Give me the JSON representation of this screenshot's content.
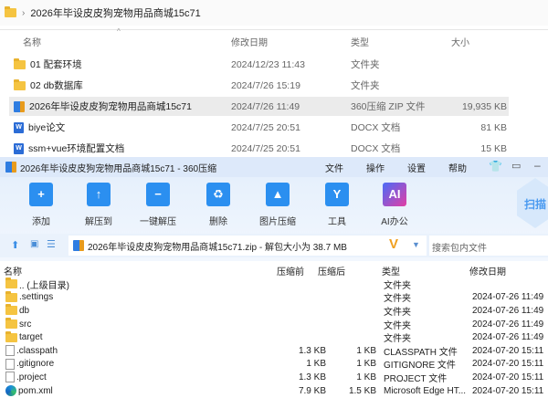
{
  "explorer": {
    "breadcrumb": "2026年毕设皮皮狗宠物用品商城15c71",
    "columns": {
      "name": "名称",
      "date": "修改日期",
      "type": "类型",
      "size": "大小"
    },
    "rows": [
      {
        "icon": "folder",
        "name": "01 配套环境",
        "date": "2024/12/23 11:43",
        "type": "文件夹",
        "size": ""
      },
      {
        "icon": "folder",
        "name": "02 db数据库",
        "date": "2024/7/26 15:19",
        "type": "文件夹",
        "size": ""
      },
      {
        "icon": "zip",
        "name": "2026年毕设皮皮狗宠物用品商城15c71",
        "date": "2024/7/26 11:49",
        "type": "360压缩 ZIP 文件",
        "size": "19,935 KB",
        "selected": true
      },
      {
        "icon": "word",
        "name": "biye论文",
        "date": "2024/7/25 20:51",
        "type": "DOCX 文档",
        "size": "81 KB"
      },
      {
        "icon": "word",
        "name": "ssm+vue环境配置文档",
        "date": "2024/7/25 20:51",
        "type": "DOCX 文档",
        "size": "15 KB"
      }
    ]
  },
  "zip": {
    "title": "2026年毕设皮皮狗宠物用品商城15c71 - 360压缩",
    "menu": [
      "文件",
      "操作",
      "设置",
      "帮助"
    ],
    "tools": [
      {
        "label": "添加",
        "glyph": "+"
      },
      {
        "label": "解压到",
        "glyph": "↑"
      },
      {
        "label": "一键解压",
        "glyph": "−"
      },
      {
        "label": "删除",
        "glyph": "♻"
      },
      {
        "label": "图片压缩",
        "glyph": "▲"
      },
      {
        "label": "工具",
        "glyph": "Y"
      },
      {
        "label": "AI办公",
        "glyph": "AI"
      }
    ],
    "scan_label": "扫描",
    "path": "2026年毕设皮皮狗宠物用品商城15c71.zip - 解包大小为 38.7 MB",
    "search_placeholder": "搜索包内文件",
    "columns": {
      "name": "名称",
      "before": "压缩前",
      "after": "压缩后",
      "type": "类型",
      "date": "修改日期"
    },
    "rows": [
      {
        "icon": "folder",
        "name": ".. (上级目录)",
        "before": "",
        "after": "",
        "type": "文件夹",
        "date": ""
      },
      {
        "icon": "folder",
        "name": ".settings",
        "before": "",
        "after": "",
        "type": "文件夹",
        "date": "2024-07-26 11:49"
      },
      {
        "icon": "folder",
        "name": "db",
        "before": "",
        "after": "",
        "type": "文件夹",
        "date": "2024-07-26 11:49"
      },
      {
        "icon": "folder",
        "name": "src",
        "before": "",
        "after": "",
        "type": "文件夹",
        "date": "2024-07-26 11:49"
      },
      {
        "icon": "folder",
        "name": "target",
        "before": "",
        "after": "",
        "type": "文件夹",
        "date": "2024-07-26 11:49"
      },
      {
        "icon": "file",
        "name": ".classpath",
        "before": "1.3 KB",
        "after": "1 KB",
        "type": "CLASSPATH 文件",
        "date": "2024-07-20 15:11"
      },
      {
        "icon": "file",
        "name": ".gitignore",
        "before": "1 KB",
        "after": "1 KB",
        "type": "GITIGNORE 文件",
        "date": "2024-07-20 15:11"
      },
      {
        "icon": "file",
        "name": ".project",
        "before": "1.3 KB",
        "after": "1 KB",
        "type": "PROJECT 文件",
        "date": "2024-07-20 15:11"
      },
      {
        "icon": "edge",
        "name": "pom.xml",
        "before": "7.9 KB",
        "after": "1.5 KB",
        "type": "Microsoft Edge HT...",
        "date": "2024-07-20 15:11"
      }
    ]
  }
}
